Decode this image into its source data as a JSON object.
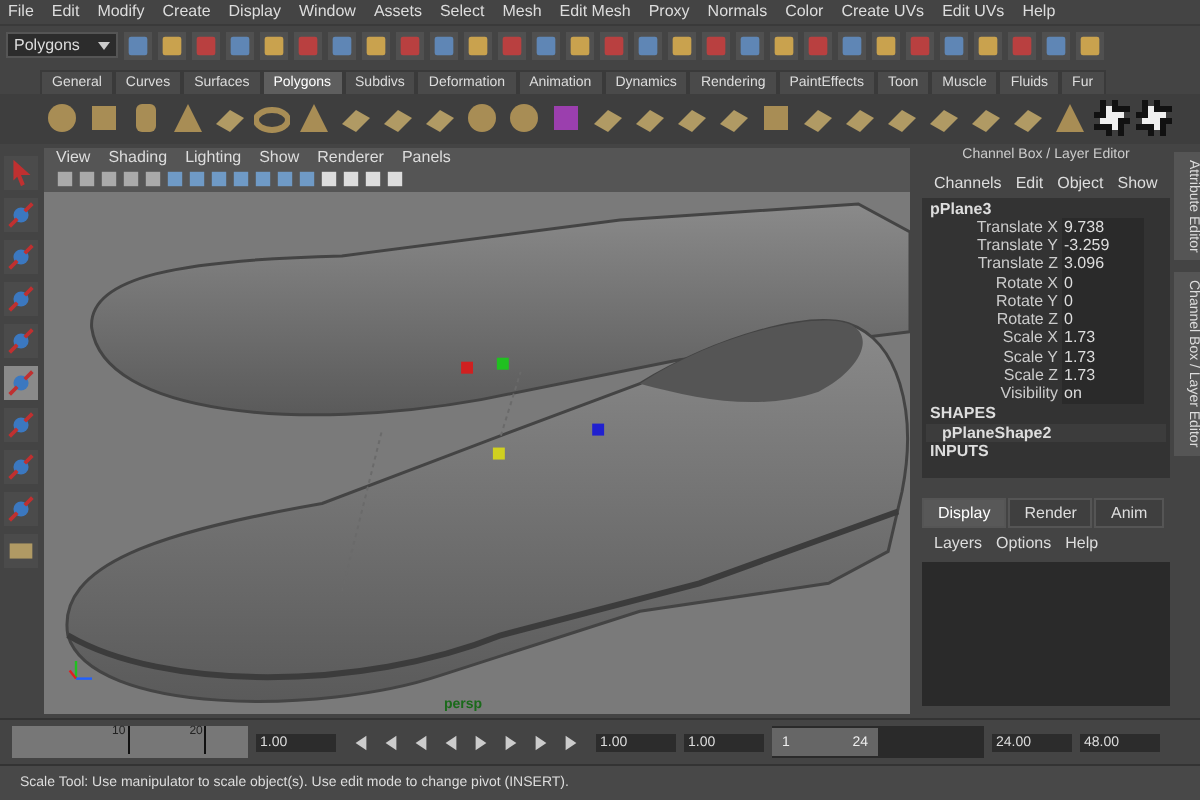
{
  "menu_bar": [
    "File",
    "Edit",
    "Modify",
    "Create",
    "Display",
    "Window",
    "Assets",
    "Select",
    "Mesh",
    "Edit Mesh",
    "Proxy",
    "Normals",
    "Color",
    "Create UVs",
    "Edit UVs",
    "Help"
  ],
  "status_line": {
    "mode": "Polygons"
  },
  "shelf_tabs": [
    {
      "label": "General",
      "selected": false
    },
    {
      "label": "Curves",
      "selected": false
    },
    {
      "label": "Surfaces",
      "selected": false
    },
    {
      "label": "Polygons",
      "selected": true
    },
    {
      "label": "Subdivs",
      "selected": false
    },
    {
      "label": "Deformation",
      "selected": false
    },
    {
      "label": "Animation",
      "selected": false
    },
    {
      "label": "Dynamics",
      "selected": false
    },
    {
      "label": "Rendering",
      "selected": false
    },
    {
      "label": "PaintEffects",
      "selected": false
    },
    {
      "label": "Toon",
      "selected": false
    },
    {
      "label": "Muscle",
      "selected": false
    },
    {
      "label": "Fluids",
      "selected": false
    },
    {
      "label": "Fur",
      "selected": false
    }
  ],
  "viewport": {
    "menu": [
      "View",
      "Shading",
      "Lighting",
      "Show",
      "Renderer",
      "Panels"
    ],
    "camera_label": "persp"
  },
  "channel_box": {
    "title": "Channel Box / Layer Editor",
    "menu": [
      "Channels",
      "Edit",
      "Object",
      "Show"
    ],
    "object": "pPlane3",
    "attributes": [
      {
        "label": "Translate X",
        "value": "9.738"
      },
      {
        "label": "Translate Y",
        "value": "-3.259"
      },
      {
        "label": "Translate Z",
        "value": "3.096"
      },
      {
        "label": "Rotate X",
        "value": "0"
      },
      {
        "label": "Rotate Y",
        "value": "0"
      },
      {
        "label": "Rotate Z",
        "value": "0"
      },
      {
        "label": "Scale X",
        "value": "1.73"
      },
      {
        "label": "Scale Y",
        "value": "1.73"
      },
      {
        "label": "Scale Z",
        "value": "1.73"
      },
      {
        "label": "Visibility",
        "value": "on"
      }
    ],
    "shapes_heading": "SHAPES",
    "shape": "pPlaneShape2",
    "inputs_heading": "INPUTS"
  },
  "layer_editor": {
    "tabs": [
      {
        "label": "Display",
        "selected": true
      },
      {
        "label": "Render",
        "selected": false
      },
      {
        "label": "Anim",
        "selected": false
      }
    ],
    "menu": [
      "Layers",
      "Options",
      "Help"
    ]
  },
  "side_tabs": [
    "Attribute Editor",
    "Channel Box / Layer Editor"
  ],
  "time_slider": {
    "ticks": [
      "10",
      "20"
    ],
    "current_time": "1.00",
    "start": "1.00",
    "playback_start": "1.00",
    "range_start": "1",
    "range_end": "24",
    "range": {
      "level": 0.5
    },
    "playback_end": "24.00",
    "end": "48.00"
  },
  "help_line": "Scale Tool: Use manipulator to scale object(s). Use edit mode to change pivot (INSERT)."
}
